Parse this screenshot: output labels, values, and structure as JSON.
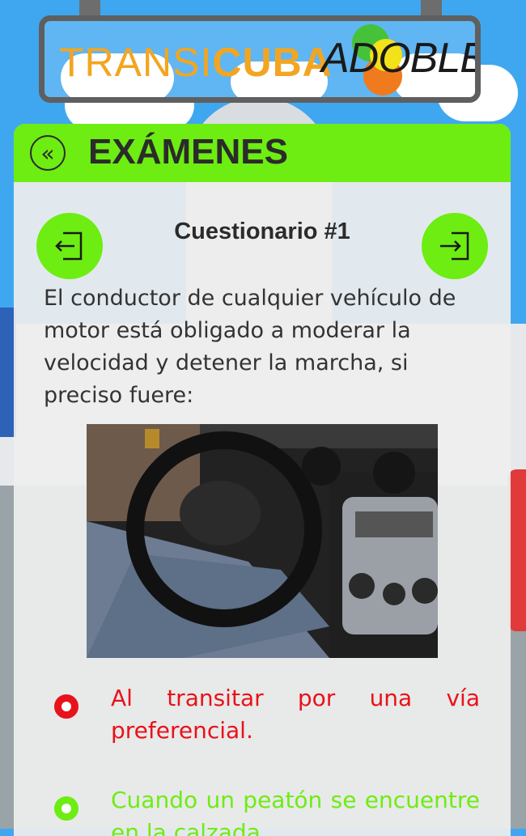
{
  "brand": {
    "transi": "TRANSI",
    "cuba": "CUBA",
    "adoble": "ADOBLE"
  },
  "header": {
    "title": "EXÁMENES",
    "back_icon": "double-chevron-left-icon"
  },
  "quiz": {
    "title": "Cuestionario #1",
    "prev_icon": "exit-left-icon",
    "next_icon": "enter-right-icon",
    "question": "El conductor de cualquier vehículo de motor está obligado a moderar la velocidad y detener la marcha, si preciso fuere:",
    "image_description_icon": "car-interior-photo",
    "answers": [
      {
        "text": "Al transitar por una vía preferencial.",
        "color": "#e8121a",
        "state": "selected"
      },
      {
        "text": "Cuando un peatón se encuentre en la calzada.",
        "color": "#6ded12",
        "state": "unselected"
      }
    ]
  },
  "colors": {
    "accent": "#6ded12",
    "wrong": "#e8121a",
    "brand_orange": "#f3a521"
  }
}
